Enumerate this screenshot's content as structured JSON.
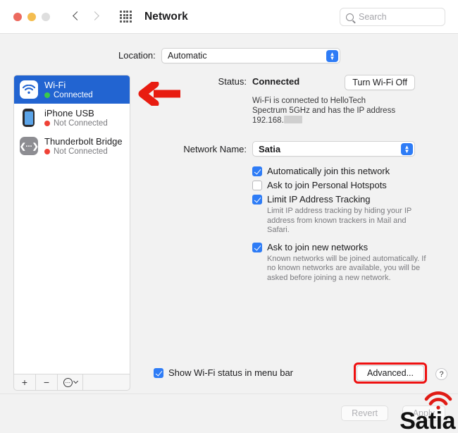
{
  "window": {
    "title": "Network",
    "traffic_lights": [
      "close",
      "minimize",
      "zoom"
    ],
    "back_icon": "chevron-left-icon",
    "forward_icon": "chevron-right-icon",
    "grid_icon": "grid-apps-icon"
  },
  "search": {
    "placeholder": "Search",
    "value": "",
    "icon": "search-icon"
  },
  "location": {
    "label": "Location:",
    "value": "Automatic",
    "options": [
      "Automatic"
    ]
  },
  "sidebar": {
    "items": [
      {
        "name": "Wi-Fi",
        "status": "Connected",
        "status_color": "#3bc94a",
        "icon": "wifi-icon",
        "selected": true
      },
      {
        "name": "iPhone USB",
        "status": "Not Connected",
        "status_color": "#ef4136",
        "icon": "iphone-icon",
        "selected": false
      },
      {
        "name": "Thunderbolt Bridge",
        "status": "Not Connected",
        "status_color": "#ef4136",
        "icon": "thunderbolt-bridge-icon",
        "selected": false
      }
    ],
    "toolbar": {
      "add_label": "+",
      "remove_label": "−",
      "actions_icon": "ellipsis-circle-icon"
    }
  },
  "detail": {
    "status_label": "Status:",
    "status_value": "Connected",
    "turn_off_button": "Turn Wi-Fi Off",
    "status_description_line1": "Wi-Fi is connected to HelloTech Spectrum",
    "status_description_line2_prefix": "5GHz and has the IP address 192.168.",
    "network_name_label": "Network Name:",
    "network_name_value": "Satia",
    "checkboxes": [
      {
        "label": "Automatically join this network",
        "checked": true,
        "help": ""
      },
      {
        "label": "Ask to join Personal Hotspots",
        "checked": false,
        "help": ""
      },
      {
        "label": "Limit IP Address Tracking",
        "checked": true,
        "help": "Limit IP address tracking by hiding your IP address from known trackers in Mail and Safari."
      },
      {
        "label": "Ask to join new networks",
        "checked": true,
        "help": "Known networks will be joined automatically. If no known networks are available, you will be asked before joining a new network."
      }
    ],
    "show_status_checkbox": {
      "label": "Show Wi-Fi status in menu bar",
      "checked": true
    },
    "advanced_button": "Advanced...",
    "help_button": "?"
  },
  "footer": {
    "revert_button": "Revert",
    "apply_button": "Apply"
  },
  "annotations": {
    "arrow_icon": "red-left-arrow-annotation",
    "arrow_color": "#e81c11",
    "highlight_color": "#ee1111",
    "watermark_text": "Satia",
    "watermark_icon": "wifi-arc-icon"
  }
}
